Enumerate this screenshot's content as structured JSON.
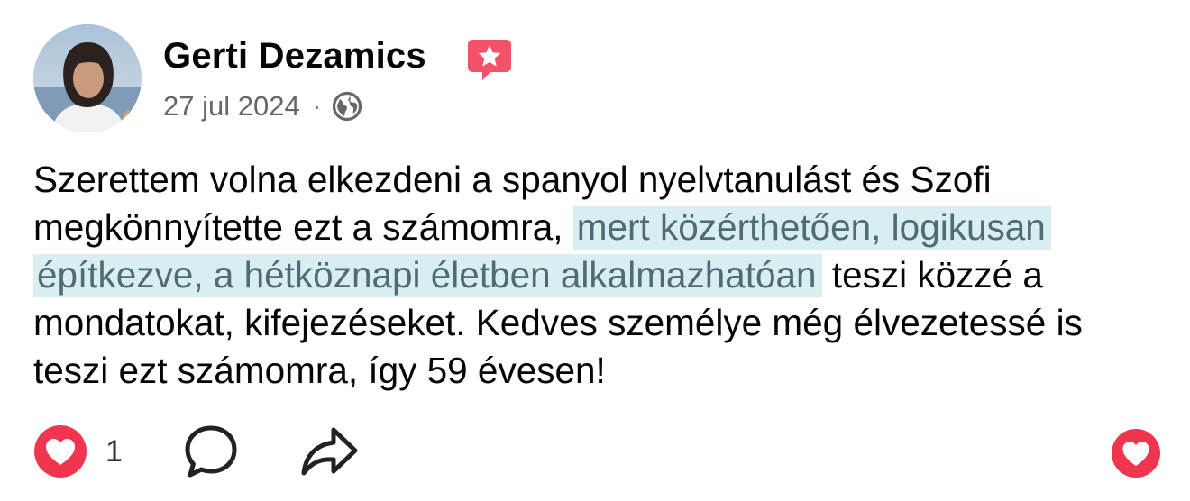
{
  "post": {
    "author": "Gerti Dezamics",
    "date": "27 jul 2024",
    "separator": "·",
    "text_before": "Szerettem volna elkezdeni a spanyol nyelvtanulást és Szofi megkönnyítette ezt a számomra, ",
    "text_highlighted": "mert közérthetően, logikusan építkezve, a hétköznapi életben alkalmazhatóan",
    "text_after": " teszi közzé a mondatokat, kifejezéseket. Kedves személye még élvezetessé is teszi ezt számomra, így 59 évesen!"
  },
  "actions": {
    "like_count": "1"
  },
  "icons": {
    "badge": "star-badge-icon",
    "audience": "globe-icon",
    "reaction": "heart-icon",
    "comment": "comment-icon",
    "share": "share-icon"
  },
  "colors": {
    "heart": "#f0364f",
    "badge": "#f4516a",
    "highlight_bg": "#d8eef1",
    "highlight_text": "#4d6c75",
    "muted": "#65676b"
  }
}
